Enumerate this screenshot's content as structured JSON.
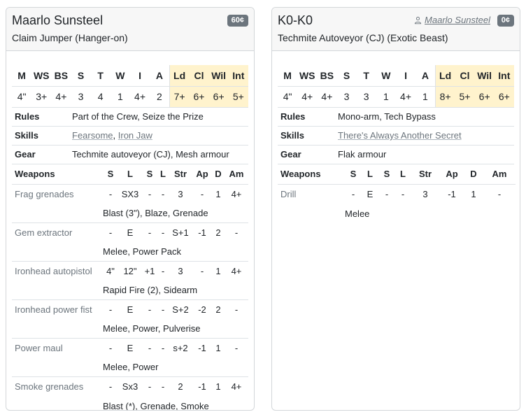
{
  "cards": [
    {
      "name": "Maarlo Sunsteel",
      "type": "Claim Jumper (Hanger-on)",
      "cost": "60¢",
      "owner": "",
      "stat_headers": [
        "M",
        "WS",
        "BS",
        "S",
        "T",
        "W",
        "I",
        "A",
        "Ld",
        "Cl",
        "Wil",
        "Int"
      ],
      "stat_values": [
        "4\"",
        "3+",
        "4+",
        "3",
        "4",
        "1",
        "4+",
        "2",
        "7+",
        "6+",
        "6+",
        "5+"
      ],
      "rules_label": "Rules",
      "rules": "Part of the Crew, Seize the Prize",
      "skills_label": "Skills",
      "skills": [
        "Fearsome",
        "Iron Jaw"
      ],
      "skills_separator": ", ",
      "gear_label": "Gear",
      "gear": "Techmite autoveyor (CJ), Mesh armour",
      "weapon_headers": [
        "Weapons",
        "S",
        "L",
        "S",
        "L",
        "Str",
        "Ap",
        "D",
        "Am"
      ],
      "weapons": [
        {
          "name": "Frag grenades",
          "stats": [
            "-",
            "SX3",
            "-",
            "-",
            "3",
            "-",
            "1",
            "4+"
          ],
          "traits": "Blast (3\"), Blaze, Grenade"
        },
        {
          "name": "Gem extractor",
          "stats": [
            "-",
            "E",
            "-",
            "-",
            "S+1",
            "-1",
            "2",
            "-"
          ],
          "traits": "Melee, Power Pack"
        },
        {
          "name": "Ironhead autopistol",
          "stats": [
            "4\"",
            "12\"",
            "+1",
            "-",
            "3",
            "-",
            "1",
            "4+"
          ],
          "traits": "Rapid Fire (2), Sidearm"
        },
        {
          "name": "Ironhead power fist",
          "stats": [
            "-",
            "E",
            "-",
            "-",
            "S+2",
            "-2",
            "2",
            "-"
          ],
          "traits": "Melee, Power, Pulverise"
        },
        {
          "name": "Power maul",
          "stats": [
            "-",
            "E",
            "-",
            "-",
            "s+2",
            "-1",
            "1",
            "-"
          ],
          "traits": "Melee, Power"
        },
        {
          "name": "Smoke grenades",
          "stats": [
            "-",
            "Sx3",
            "-",
            "-",
            "2",
            "-1",
            "1",
            "4+"
          ],
          "traits": "Blast (*), Grenade, Smoke"
        }
      ]
    },
    {
      "name": "K0-K0",
      "type": "Techmite Autoveyor (CJ) (Exotic Beast)",
      "cost": "0¢",
      "owner": "Maarlo Sunsteel",
      "stat_headers": [
        "M",
        "WS",
        "BS",
        "S",
        "T",
        "W",
        "I",
        "A",
        "Ld",
        "Cl",
        "Wil",
        "Int"
      ],
      "stat_values": [
        "4\"",
        "4+",
        "4+",
        "3",
        "3",
        "1",
        "4+",
        "1",
        "8+",
        "5+",
        "6+",
        "6+"
      ],
      "rules_label": "Rules",
      "rules": "Mono-arm, Tech Bypass",
      "skills_label": "Skills",
      "skills": [
        "There's Always Another Secret"
      ],
      "skills_separator": "",
      "gear_label": "Gear",
      "gear": "Flak armour",
      "weapon_headers": [
        "Weapons",
        "S",
        "L",
        "S",
        "L",
        "Str",
        "Ap",
        "D",
        "Am"
      ],
      "weapons": [
        {
          "name": "Drill",
          "stats": [
            "-",
            "E",
            "-",
            "-",
            "3",
            "-1",
            "1",
            "-"
          ],
          "traits": "Melee"
        }
      ]
    }
  ],
  "colors": {
    "highlight": "#fff3cd",
    "badge": "#6c757d",
    "muted": "#6c757d"
  },
  "icons": {
    "owner": "person-icon"
  }
}
